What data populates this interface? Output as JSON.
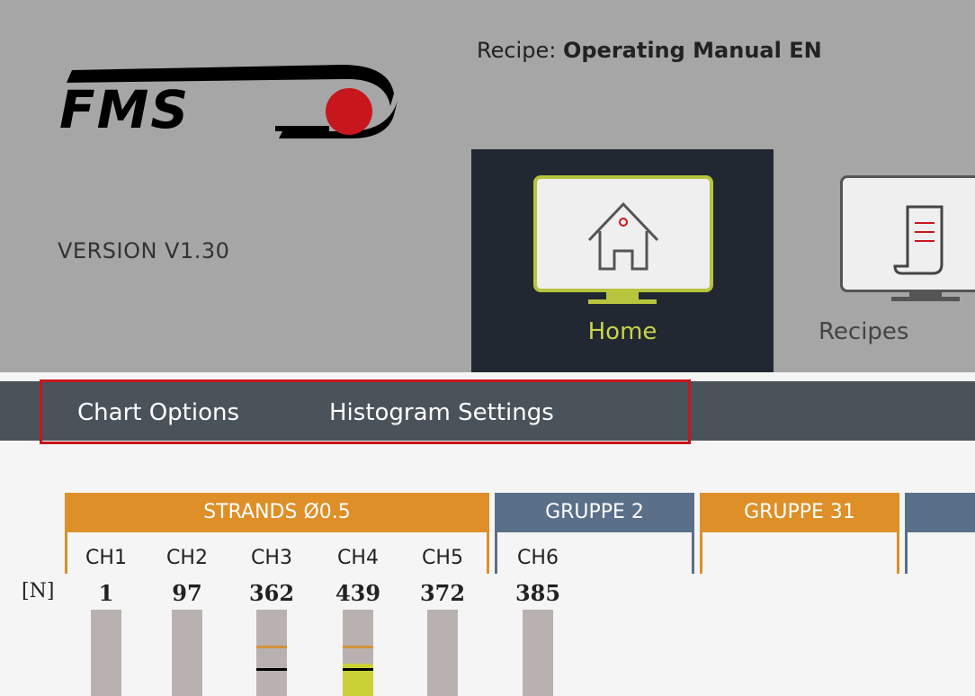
{
  "header": {
    "logo_text": "FMS",
    "recipe_label": "Recipe:",
    "recipe_name": "Operating Manual EN",
    "version": "VERSION V1.30"
  },
  "nav": {
    "items": [
      {
        "label": "Home",
        "icon": "home-icon",
        "active": true
      },
      {
        "label": "Recipes",
        "icon": "recipes-icon",
        "active": false
      }
    ]
  },
  "menu": {
    "items": [
      {
        "label": "Chart Options"
      },
      {
        "label": "Histogram Settings"
      }
    ]
  },
  "groups": [
    {
      "name": "STRANDS Ø0.5",
      "color": "#de8f27"
    },
    {
      "name": "GRUPPE 2",
      "color": "#5a6f88"
    },
    {
      "name": "GRUPPE 31",
      "color": "#de8f27"
    },
    {
      "name": "",
      "color": "#5a6f88"
    }
  ],
  "unit": "[N]",
  "channels": [
    {
      "label": "CH1",
      "value": "1",
      "fill": 0,
      "orange": null,
      "black": null
    },
    {
      "label": "CH2",
      "value": "97",
      "fill": 0,
      "orange": null,
      "black": null
    },
    {
      "label": "CH3",
      "value": "362",
      "fill": 0,
      "orange": 0.4,
      "black": 0.65
    },
    {
      "label": "CH4",
      "value": "439",
      "fill": 0.4,
      "orange": 0.4,
      "black": 0.65
    },
    {
      "label": "CH5",
      "value": "372",
      "fill": 0,
      "orange": null,
      "black": null
    },
    {
      "label": "CH6",
      "value": "385",
      "fill": 0,
      "orange": null,
      "black": null
    }
  ],
  "colors": {
    "header_bg": "#a6a6a6",
    "nav_active_bg": "#212831",
    "accent_green": "#b7c43d",
    "menu_bg": "#4a525a",
    "highlight_red": "#c8161d",
    "bar_bg": "#b9b1b0"
  }
}
